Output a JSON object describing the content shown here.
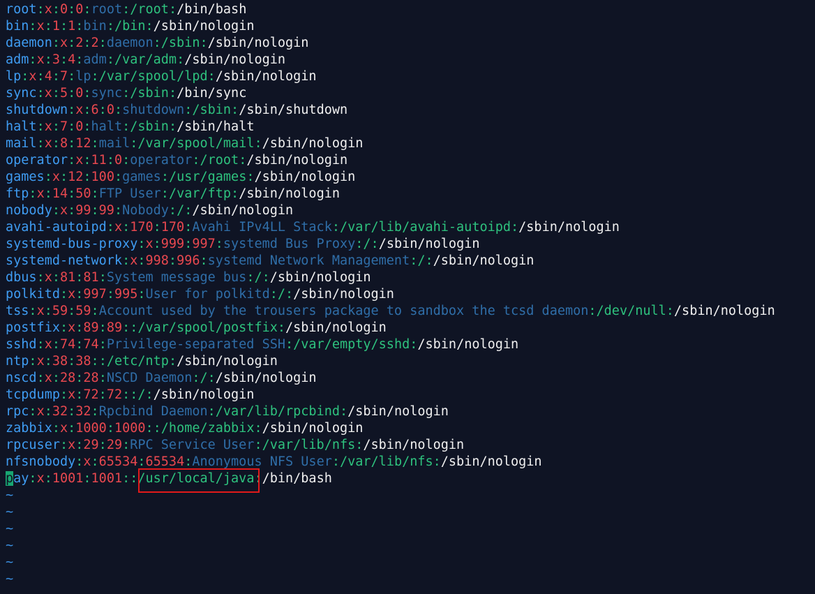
{
  "colors": {
    "background": "#0f1424",
    "user": "#3f9cf2",
    "colon": "#2ec27e",
    "x": "#e8484f",
    "number": "#e8484f",
    "gecos": "#2f6ea8",
    "home": "#2ec27e",
    "shell": "#f0f0f0",
    "cursor": "#18a672",
    "highlight": "#e11a1a",
    "tilde": "#3a8fe0"
  },
  "highlight": {
    "text": "/usr/local/java"
  },
  "cursor_char": "p",
  "tilde": "~",
  "tilde_count": 6,
  "lines": [
    [
      "root",
      "x",
      "0",
      "0",
      "root",
      "/root",
      "/bin/bash"
    ],
    [
      "bin",
      "x",
      "1",
      "1",
      "bin",
      "/bin",
      "/sbin/nologin"
    ],
    [
      "daemon",
      "x",
      "2",
      "2",
      "daemon",
      "/sbin",
      "/sbin/nologin"
    ],
    [
      "adm",
      "x",
      "3",
      "4",
      "adm",
      "/var/adm",
      "/sbin/nologin"
    ],
    [
      "lp",
      "x",
      "4",
      "7",
      "lp",
      "/var/spool/lpd",
      "/sbin/nologin"
    ],
    [
      "sync",
      "x",
      "5",
      "0",
      "sync",
      "/sbin",
      "/bin/sync"
    ],
    [
      "shutdown",
      "x",
      "6",
      "0",
      "shutdown",
      "/sbin",
      "/sbin/shutdown"
    ],
    [
      "halt",
      "x",
      "7",
      "0",
      "halt",
      "/sbin",
      "/sbin/halt"
    ],
    [
      "mail",
      "x",
      "8",
      "12",
      "mail",
      "/var/spool/mail",
      "/sbin/nologin"
    ],
    [
      "operator",
      "x",
      "11",
      "0",
      "operator",
      "/root",
      "/sbin/nologin"
    ],
    [
      "games",
      "x",
      "12",
      "100",
      "games",
      "/usr/games",
      "/sbin/nologin"
    ],
    [
      "ftp",
      "x",
      "14",
      "50",
      "FTP User",
      "/var/ftp",
      "/sbin/nologin"
    ],
    [
      "nobody",
      "x",
      "99",
      "99",
      "Nobody",
      "/",
      "/sbin/nologin"
    ],
    [
      "avahi-autoipd",
      "x",
      "170",
      "170",
      "Avahi IPv4LL Stack",
      "/var/lib/avahi-autoipd",
      "/sbin/nologin"
    ],
    [
      "systemd-bus-proxy",
      "x",
      "999",
      "997",
      "systemd Bus Proxy",
      "/",
      "/sbin/nologin"
    ],
    [
      "systemd-network",
      "x",
      "998",
      "996",
      "systemd Network Management",
      "/",
      "/sbin/nologin"
    ],
    [
      "dbus",
      "x",
      "81",
      "81",
      "System message bus",
      "/",
      "/sbin/nologin"
    ],
    [
      "polkitd",
      "x",
      "997",
      "995",
      "User for polkitd",
      "/",
      "/sbin/nologin"
    ],
    [
      "tss",
      "x",
      "59",
      "59",
      "Account used by the trousers package to sandbox the tcsd daemon",
      "/dev/null",
      "/sbin/nologin"
    ],
    [
      "postfix",
      "x",
      "89",
      "89",
      "",
      "/var/spool/postfix",
      "/sbin/nologin"
    ],
    [
      "sshd",
      "x",
      "74",
      "74",
      "Privilege-separated SSH",
      "/var/empty/sshd",
      "/sbin/nologin"
    ],
    [
      "ntp",
      "x",
      "38",
      "38",
      "",
      "/etc/ntp",
      "/sbin/nologin"
    ],
    [
      "nscd",
      "x",
      "28",
      "28",
      "NSCD Daemon",
      "/",
      "/sbin/nologin"
    ],
    [
      "tcpdump",
      "x",
      "72",
      "72",
      "",
      "/",
      "/sbin/nologin"
    ],
    [
      "rpc",
      "x",
      "32",
      "32",
      "Rpcbind Daemon",
      "/var/lib/rpcbind",
      "/sbin/nologin"
    ],
    [
      "zabbix",
      "x",
      "1000",
      "1000",
      "",
      "/home/zabbix",
      "/sbin/nologin"
    ],
    [
      "rpcuser",
      "x",
      "29",
      "29",
      "RPC Service User",
      "/var/lib/nfs",
      "/sbin/nologin"
    ],
    [
      "nfsnobody",
      "x",
      "65534",
      "65534",
      "Anonymous NFS User",
      "/var/lib/nfs",
      "/sbin/nologin"
    ],
    [
      "pay",
      "x",
      "1001",
      "1001",
      "",
      "/usr/local/java",
      "/bin/bash"
    ]
  ]
}
